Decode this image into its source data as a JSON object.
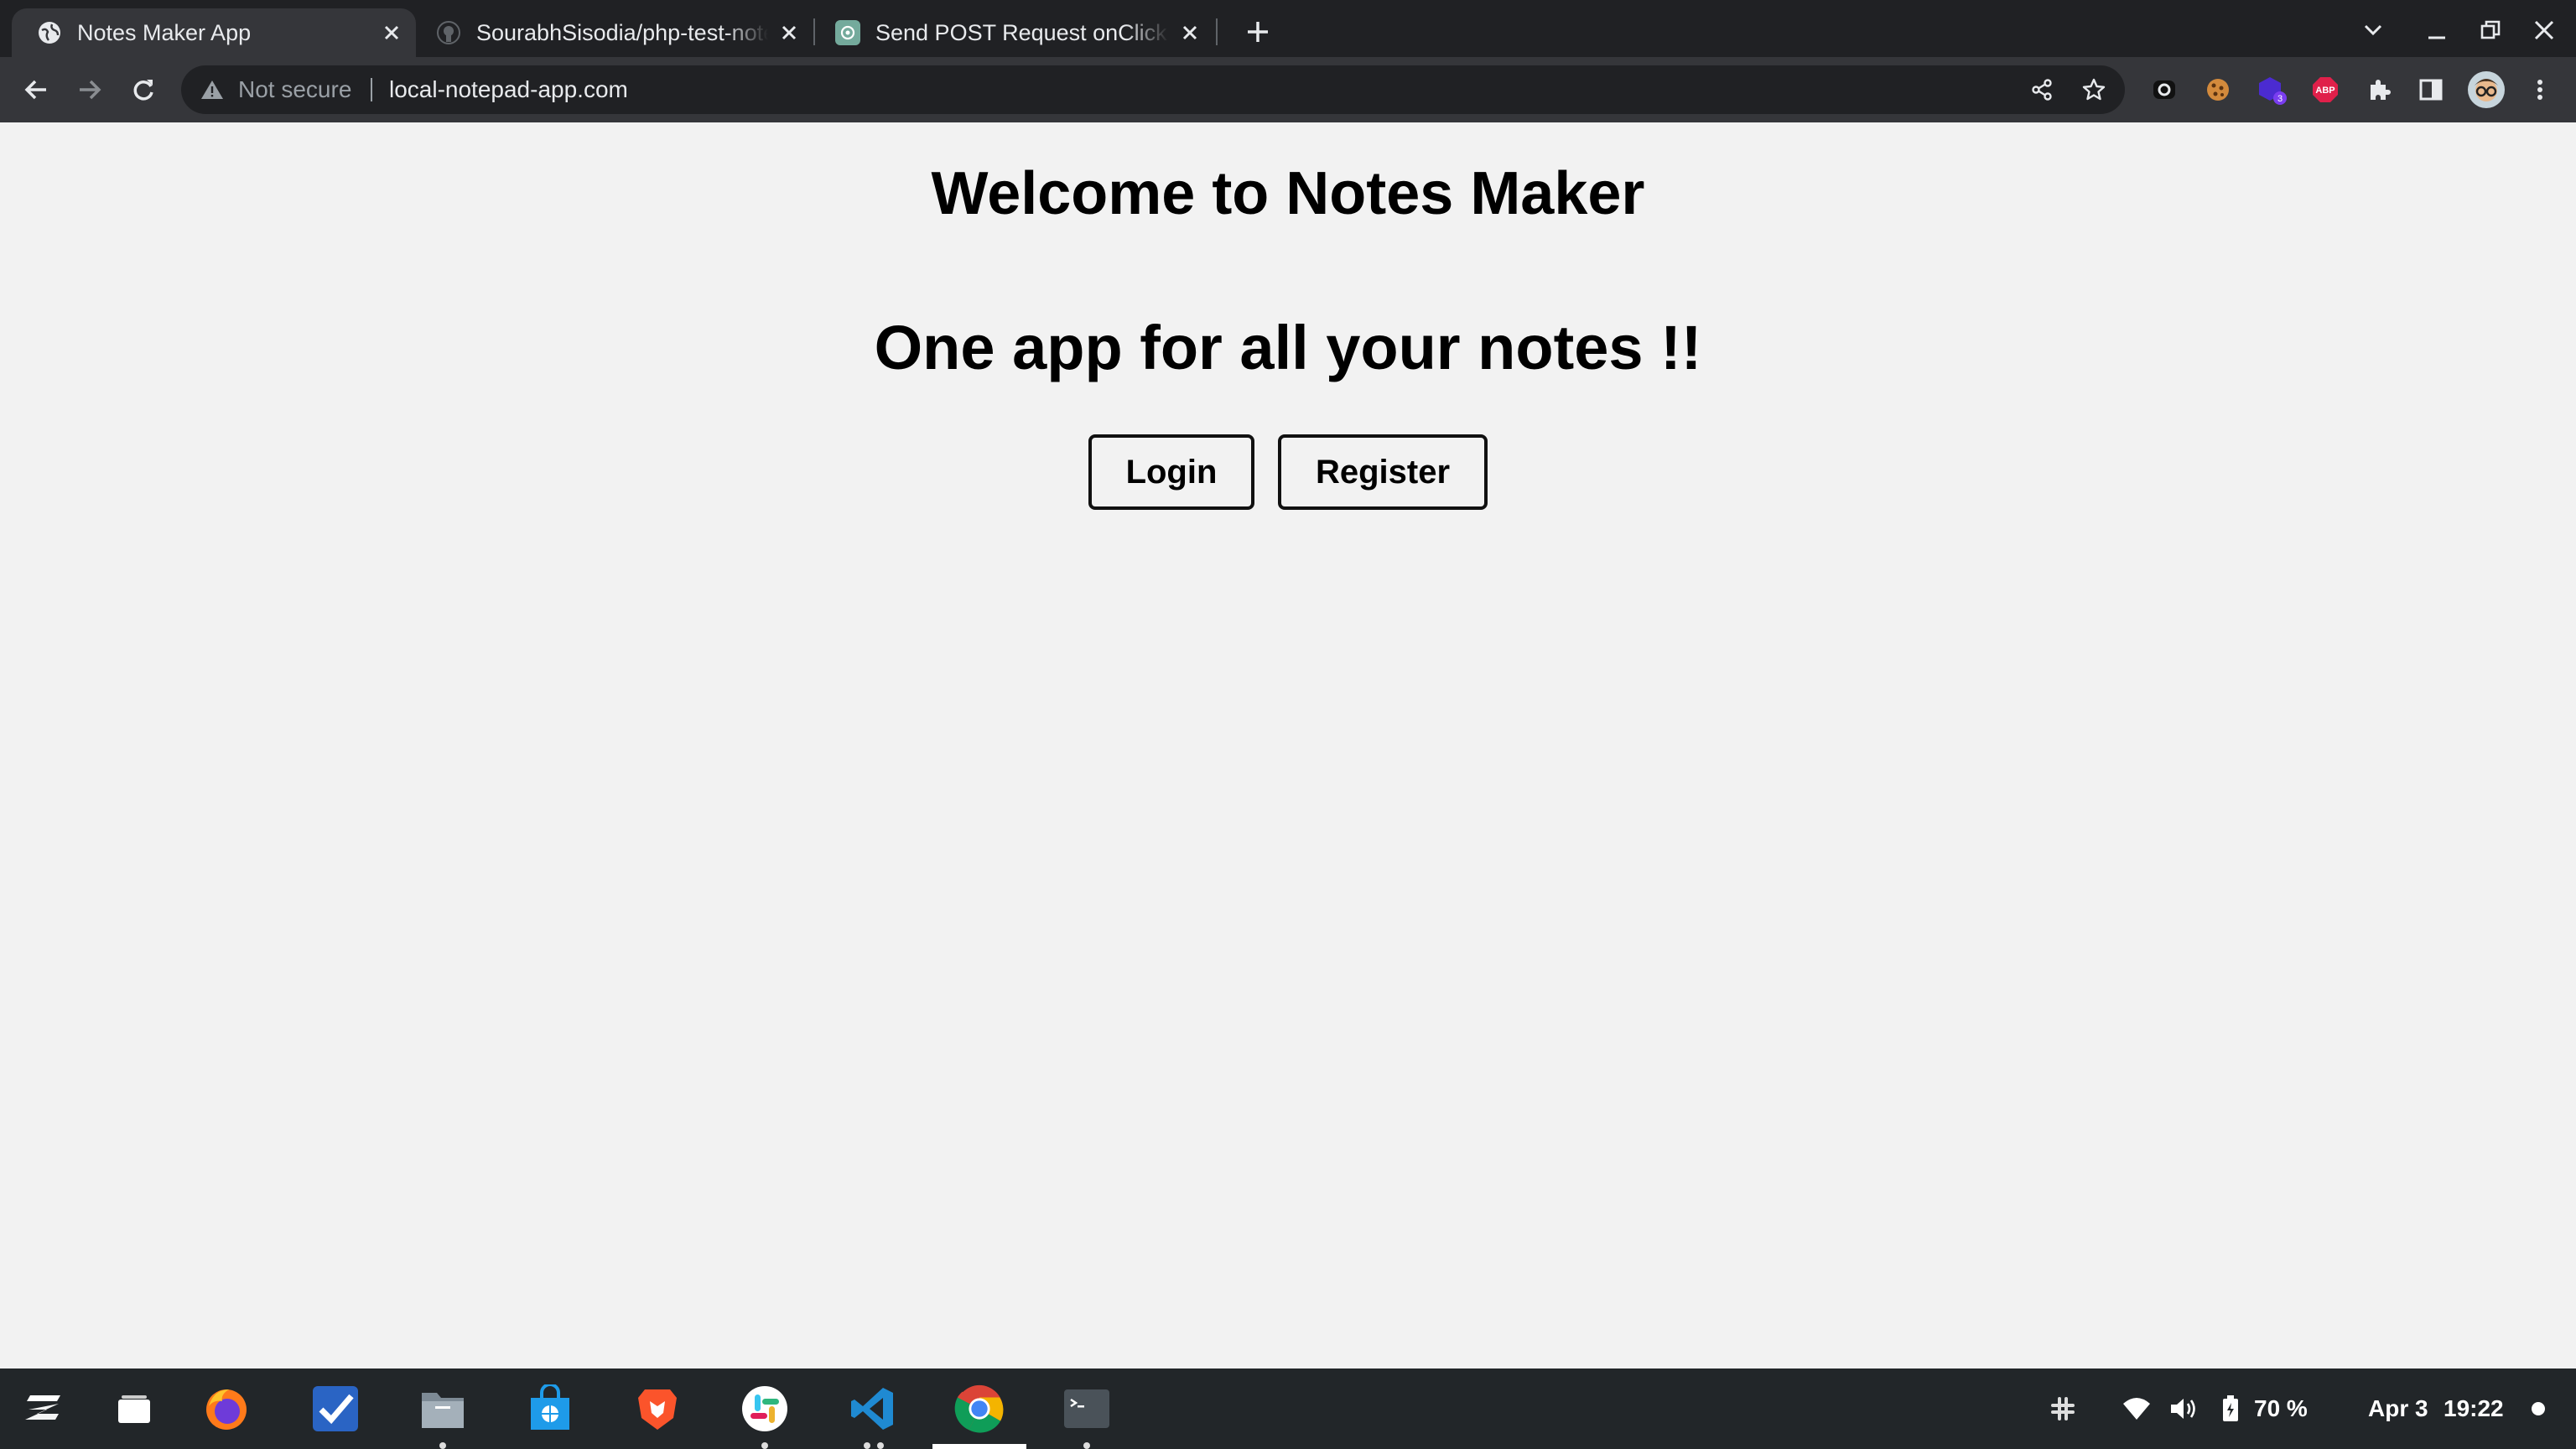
{
  "browser": {
    "tabs": [
      {
        "title": "Notes Maker App",
        "active": true,
        "favicon": "globe-icon"
      },
      {
        "title": "SourabhSisodia/php-test-notes",
        "active": false,
        "favicon": "github-icon"
      },
      {
        "title": "Send POST Request onClick",
        "active": false,
        "favicon": "chatgpt-icon"
      }
    ],
    "address_bar": {
      "security_label": "Not secure",
      "url": "local-notepad-app.com"
    },
    "extensions": [
      "camera-extension-icon",
      "cookie-extension-icon",
      "purple-cube-extension-icon",
      "adblock-plus-icon",
      "puzzle-extensions-icon",
      "side-panel-icon",
      "profile-avatar-icon",
      "menu-kebab-icon"
    ],
    "extension_badge": "3",
    "abp_label": "ABP"
  },
  "page": {
    "heading": "Welcome to Notes Maker",
    "tagline": "One app for all your notes !!",
    "login_label": "Login",
    "register_label": "Register"
  },
  "taskbar": {
    "apps": [
      "zorin-menu-icon",
      "files-windows-icon",
      "firefox-icon",
      "tasks-icon",
      "file-manager-icon",
      "software-store-icon",
      "brave-icon",
      "slack-icon",
      "vscode-icon",
      "chrome-icon",
      "terminal-icon"
    ],
    "battery": "70 %",
    "date": "Apr 3",
    "time": "19:22"
  },
  "colors": {
    "tab_strip": "#202124",
    "toolbar": "#35363a",
    "page_bg": "#f2f2f2",
    "taskbar": "#222629"
  }
}
